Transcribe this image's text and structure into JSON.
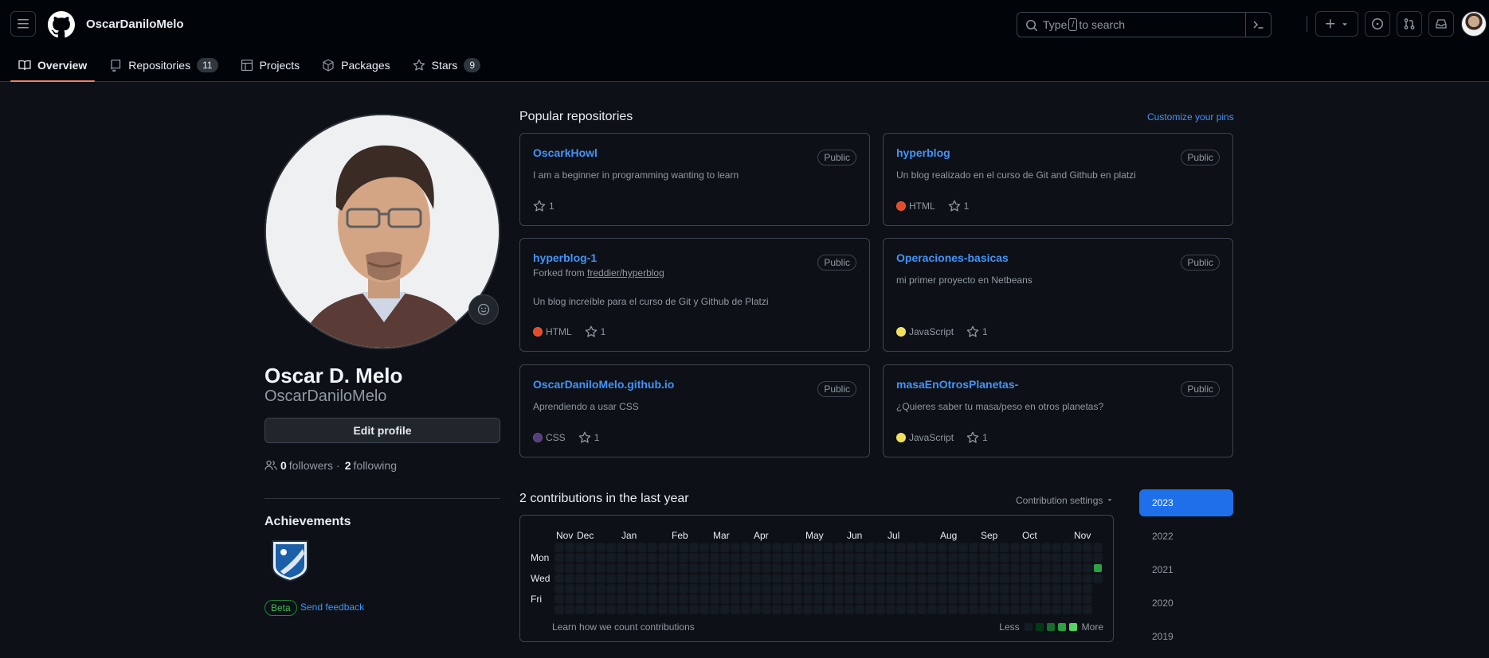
{
  "header": {
    "username": "OscarDaniloMelo",
    "search_text_before": "Type",
    "search_key": "/",
    "search_text_after": "to search"
  },
  "tabs": [
    {
      "label": "Overview",
      "icon": "book-icon",
      "active": true
    },
    {
      "label": "Repositories",
      "icon": "repo-icon",
      "count": "11"
    },
    {
      "label": "Projects",
      "icon": "table-icon"
    },
    {
      "label": "Packages",
      "icon": "package-icon"
    },
    {
      "label": "Stars",
      "icon": "star-icon",
      "count": "9"
    }
  ],
  "profile": {
    "name": "Oscar D. Melo",
    "login": "OscarDaniloMelo",
    "edit_label": "Edit profile",
    "followers_count": "0",
    "followers_label": "followers",
    "separator": "·",
    "following_count": "2",
    "following_label": "following",
    "achievements_title": "Achievements",
    "beta_label": "Beta",
    "feedback_label": "Send feedback"
  },
  "popular": {
    "title": "Popular repositories",
    "customize_label": "Customize your pins",
    "repos": [
      {
        "name": "OscarkHowl",
        "visibility": "Public",
        "description": "I am a beginner in programming wanting to learn",
        "language": "",
        "stars": "1"
      },
      {
        "name": "hyperblog",
        "visibility": "Public",
        "description": "Un blog realizado en el curso de Git and Github en platzi",
        "language": "HTML",
        "lang_color": "#e34c26",
        "stars": "1"
      },
      {
        "name": "hyperblog-1",
        "visibility": "Public",
        "forked_prefix": "Forked from",
        "forked_from": "freddier/hyperblog",
        "description": "Un blog increíble para el curso de Git y Github de Platzi",
        "language": "HTML",
        "lang_color": "#e34c26",
        "stars": "1"
      },
      {
        "name": "Operaciones-basicas",
        "visibility": "Public",
        "description": "mi primer proyecto en Netbeans",
        "language": "JavaScript",
        "lang_color": "#f1e05a",
        "stars": "1"
      },
      {
        "name": "OscarDaniloMelo.github.io",
        "visibility": "Public",
        "description": "Aprendiendo a usar CSS",
        "language": "CSS",
        "lang_color": "#563d7c",
        "stars": "1"
      },
      {
        "name": "masaEnOtrosPlanetas-",
        "visibility": "Public",
        "description": "¿Quieres saber tu masa/peso en otros planetas?",
        "language": "JavaScript",
        "lang_color": "#f1e05a",
        "stars": "1"
      }
    ]
  },
  "contributions": {
    "title": "2 contributions in the last year",
    "settings_label": "Contribution settings",
    "months": [
      "Nov",
      "Dec",
      "Jan",
      "Feb",
      "Mar",
      "Apr",
      "May",
      "Jun",
      "Jul",
      "Aug",
      "Sep",
      "Oct",
      "Nov"
    ],
    "days": [
      "Mon",
      "Wed",
      "Fri"
    ],
    "learn_label": "Learn how we count contributions",
    "less_label": "Less",
    "more_label": "More",
    "level_colors": [
      "#151b23",
      "#033a16",
      "#196c2e",
      "#2ea043",
      "#56d364"
    ],
    "weeks": 53,
    "active_cell": {
      "week": 52,
      "day": 2,
      "level": 3
    },
    "years": [
      "2023",
      "2022",
      "2021",
      "2020",
      "2019"
    ],
    "active_year": "2023"
  }
}
